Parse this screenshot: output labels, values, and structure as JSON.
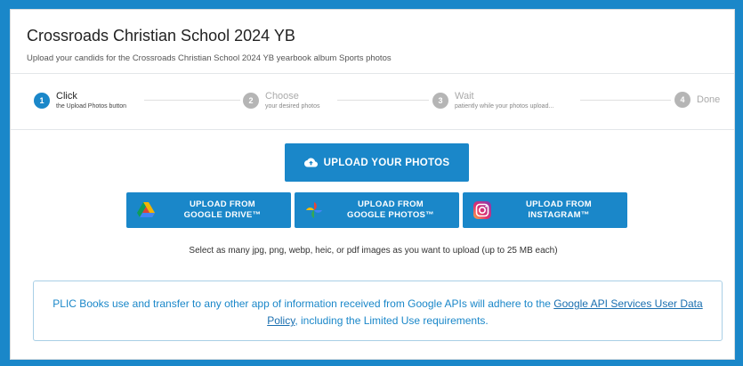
{
  "header": {
    "title": "Crossroads Christian School 2024 YB",
    "subtitle": "Upload your candids for the Crossroads Christian School 2024 YB yearbook album Sports photos"
  },
  "steps": [
    {
      "num": "1",
      "label": "Click",
      "desc": "the Upload Photos button"
    },
    {
      "num": "2",
      "label": "Choose",
      "desc": "your desired photos"
    },
    {
      "num": "3",
      "label": "Wait",
      "desc": "patiently while your photos upload..."
    },
    {
      "num": "4",
      "label": "Done",
      "desc": ""
    }
  ],
  "upload": {
    "main_label": "UPLOAD YOUR PHOTOS",
    "sources": [
      {
        "line1": "UPLOAD FROM",
        "line2": "GOOGLE DRIVE™",
        "icon": "google-drive-icon"
      },
      {
        "line1": "UPLOAD FROM",
        "line2": "GOOGLE PHOTOS™",
        "icon": "google-photos-icon"
      },
      {
        "line1": "UPLOAD FROM",
        "line2": "INSTAGRAM™",
        "icon": "instagram-icon"
      }
    ],
    "note": "Select as many jpg, png, webp, heic, or pdf images as you want to upload (up to 25 MB each)"
  },
  "policy": {
    "text_before": "PLIC Books use and transfer to any other app of information received from Google APIs will adhere to the ",
    "link_text": "Google API Services User Data Policy",
    "text_after": ", including the Limited Use requirements."
  },
  "colors": {
    "accent": "#1a87c9",
    "background": "#1a87c9",
    "step_inactive": "#b5b5b5"
  }
}
